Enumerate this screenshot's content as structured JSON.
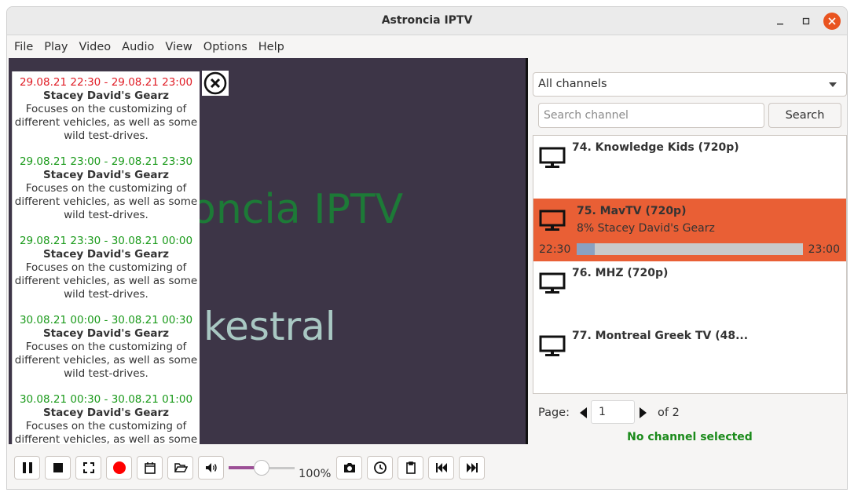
{
  "window": {
    "title": "Astroncia IPTV"
  },
  "menu": [
    "File",
    "Play",
    "Video",
    "Audio",
    "View",
    "Options",
    "Help"
  ],
  "video": {
    "overlay_line1": "oncia IPTV",
    "overlay_line2": "kestral"
  },
  "epg": {
    "items": [
      {
        "time": "29.08.21 22:30 - 29.08.21 23:00",
        "current": true,
        "name": "Stacey David's Gearz",
        "desc": "Focuses on the customizing of different vehicles, as well as some wild test-drives."
      },
      {
        "time": "29.08.21 23:00 - 29.08.21 23:30",
        "current": false,
        "name": "Stacey David's Gearz",
        "desc": "Focuses on the customizing of different vehicles, as well as some wild test-drives."
      },
      {
        "time": "29.08.21 23:30 - 30.08.21 00:00",
        "current": false,
        "name": "Stacey David's Gearz",
        "desc": "Focuses on the customizing of different vehicles, as well as some wild test-drives."
      },
      {
        "time": "30.08.21 00:00 - 30.08.21 00:30",
        "current": false,
        "name": "Stacey David's Gearz",
        "desc": "Focuses on the customizing of different vehicles, as well as some wild test-drives."
      },
      {
        "time": "30.08.21 00:30 - 30.08.21 01:00",
        "current": false,
        "name": "Stacey David's Gearz",
        "desc": "Focuses on the customizing of different vehicles, as well as some wild test-drives."
      }
    ],
    "close_icon": "circle-x-icon"
  },
  "sidebar": {
    "group_select": "All channels",
    "search_placeholder": "Search channel",
    "search_label": "Search",
    "channels": [
      {
        "name": "74. Knowledge Kids (720p)",
        "selected": false
      },
      {
        "name": "75. MavTV (720p)",
        "selected": true,
        "subtitle": "8% Stacey David's Gearz",
        "start": "22:30",
        "end": "23:00",
        "progress": 0.08
      },
      {
        "name": "76. MHZ (720p)",
        "selected": false
      },
      {
        "name": "77. Montreal Greek TV (48...",
        "selected": false
      }
    ],
    "pager": {
      "label": "Page:",
      "current": "1",
      "of_text": "of 2"
    },
    "status": "No channel selected"
  },
  "toolbar": {
    "volume": 0.5,
    "volume_text": "100%",
    "icons": [
      "pause-icon",
      "stop-icon",
      "fullscreen-icon",
      "record-icon",
      "calendar-icon",
      "folder-icon",
      "volume-icon",
      "camera-icon",
      "clock-icon",
      "clipboard-icon",
      "skip-previous-icon",
      "skip-next-icon"
    ]
  },
  "colors": {
    "accent": "#e95f35",
    "epg_current": "#e01b24",
    "epg_time": "#1a9a1a",
    "video_bg": "#3d3547",
    "slider": "#9c4f96",
    "progress_fill": "#8aa1c1"
  }
}
